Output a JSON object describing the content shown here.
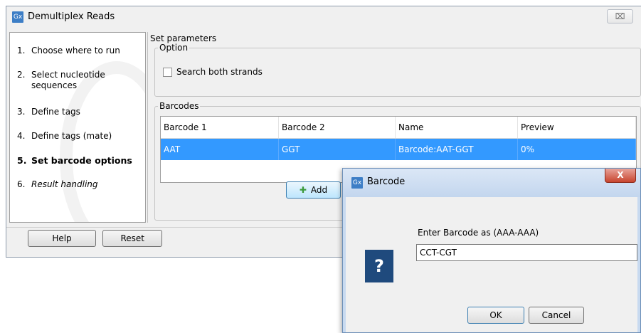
{
  "main_window": {
    "title": "Demultiplex Reads",
    "app_icon": "Gx",
    "close_label": "⌧",
    "steps": [
      {
        "num": "1.",
        "label": "Choose where to run"
      },
      {
        "num": "2.",
        "label": "Select nucleotide sequences"
      },
      {
        "num": "3.",
        "label": "Define tags"
      },
      {
        "num": "4.",
        "label": "Define tags (mate)"
      },
      {
        "num": "5.",
        "label": "Set barcode options"
      },
      {
        "num": "6.",
        "label": "Result handling"
      }
    ],
    "section_title": "Set parameters",
    "option_group": "Option",
    "search_both_strands": "Search both strands",
    "barcodes_group": "Barcodes",
    "table": {
      "columns": [
        "Barcode 1",
        "Barcode 2",
        "Name",
        "Preview"
      ],
      "rows": [
        [
          "AAT",
          "GGT",
          "Barcode:AAT-GGT",
          "0%"
        ]
      ]
    },
    "add_button": "Add",
    "help_button": "Help",
    "reset_button": "Reset"
  },
  "dialog": {
    "title": "Barcode",
    "app_icon": "Gx",
    "close_label": "X",
    "question_icon": "?",
    "prompt": "Enter Barcode as (AAA-AAA)",
    "input_value": "CCT-CGT",
    "ok_button": "OK",
    "cancel_button": "Cancel"
  },
  "colors": {
    "selection": "#3399ff",
    "dialog_frame": "#c8daf0",
    "question_icon_bg": "#1f4a7d"
  }
}
